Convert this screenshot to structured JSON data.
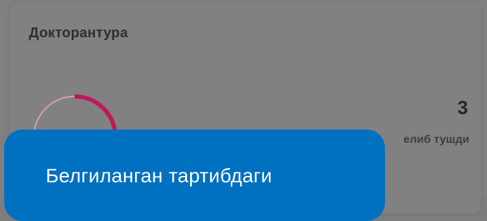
{
  "card": {
    "title": "Докторантура",
    "progress_fraction": 0.22,
    "ring_track_color": "#d6a0b0",
    "ring_progress_color": "#c2185b",
    "stat_value": "3",
    "stat_label_visible": "елиб тушди"
  },
  "tooltip": {
    "text": "Белгиланган тартибдаги",
    "background_color": "#0070c0"
  }
}
